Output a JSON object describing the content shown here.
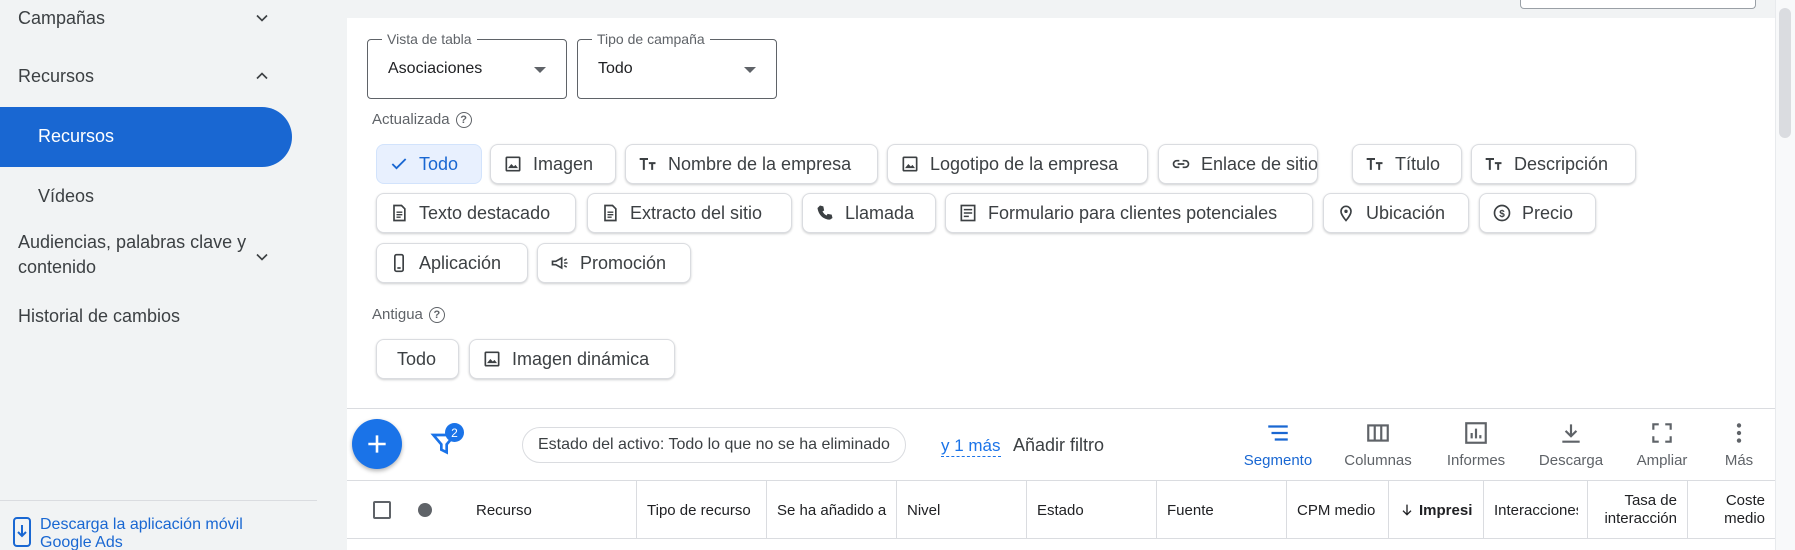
{
  "sidebar": {
    "campanas": "Campañas",
    "recursos_group": "Recursos",
    "recursos_item": "Recursos",
    "videos_item": "Vídeos",
    "audiencias": "Audiencias, palabras clave y contenido",
    "historial": "Historial de cambios",
    "download_app": "Descarga la aplicación móvil Google Ads"
  },
  "filters": {
    "table_view": {
      "label": "Vista de tabla",
      "value": "Asociaciones"
    },
    "campaign_type": {
      "label": "Tipo de campaña",
      "value": "Todo"
    }
  },
  "updated": {
    "label": "Actualizada",
    "chips": [
      {
        "label": "Todo",
        "icon": "check-icon",
        "selected": true
      },
      {
        "label": "Imagen",
        "icon": "image-icon"
      },
      {
        "label": "Nombre de la empresa",
        "icon": "text-icon"
      },
      {
        "label": "Logotipo de la empresa",
        "icon": "image-icon"
      },
      {
        "label": "Enlace de sitio",
        "icon": "link-icon"
      },
      {
        "label": "Título",
        "icon": "text-icon"
      },
      {
        "label": "Descripción",
        "icon": "text-icon"
      },
      {
        "label": "Texto destacado",
        "icon": "document-icon"
      },
      {
        "label": "Extracto del sitio",
        "icon": "document-icon"
      },
      {
        "label": "Llamada",
        "icon": "phone-icon"
      },
      {
        "label": "Formulario para clientes potenciales",
        "icon": "form-icon"
      },
      {
        "label": "Ubicación",
        "icon": "location-icon"
      },
      {
        "label": "Precio",
        "icon": "price-icon"
      },
      {
        "label": "Aplicación",
        "icon": "mobile-icon"
      },
      {
        "label": "Promoción",
        "icon": "megaphone-icon"
      }
    ]
  },
  "legacy": {
    "label": "Antigua",
    "chips": [
      {
        "label": "Todo"
      },
      {
        "label": "Imagen dinámica",
        "icon": "image-icon"
      }
    ]
  },
  "toolbar": {
    "filter_count": "2",
    "status_filter": "Estado del activo: Todo lo que no se ha eliminado",
    "more": "y 1 más",
    "add_filter": "Añadir filtro",
    "tools": [
      {
        "label": "Segmento",
        "icon": "segment-icon",
        "active": true
      },
      {
        "label": "Columnas",
        "icon": "columns-icon"
      },
      {
        "label": "Informes",
        "icon": "reports-icon"
      },
      {
        "label": "Descarga",
        "icon": "download-icon"
      },
      {
        "label": "Ampliar",
        "icon": "fullscreen-icon"
      },
      {
        "label": "Más",
        "icon": "more-vert-icon"
      }
    ]
  },
  "table": {
    "columns": [
      "Recurso",
      "Tipo de recurso",
      "Se ha añadido a",
      "Nivel",
      "Estado",
      "Fuente",
      "CPM medio",
      "Impresi",
      "Interacciones",
      "Tasa de interacción",
      "Coste medio"
    ]
  },
  "colors": {
    "accent": "#1967d2",
    "fab": "#1a73e8",
    "sidebar_bg": "#f1f3f4"
  }
}
